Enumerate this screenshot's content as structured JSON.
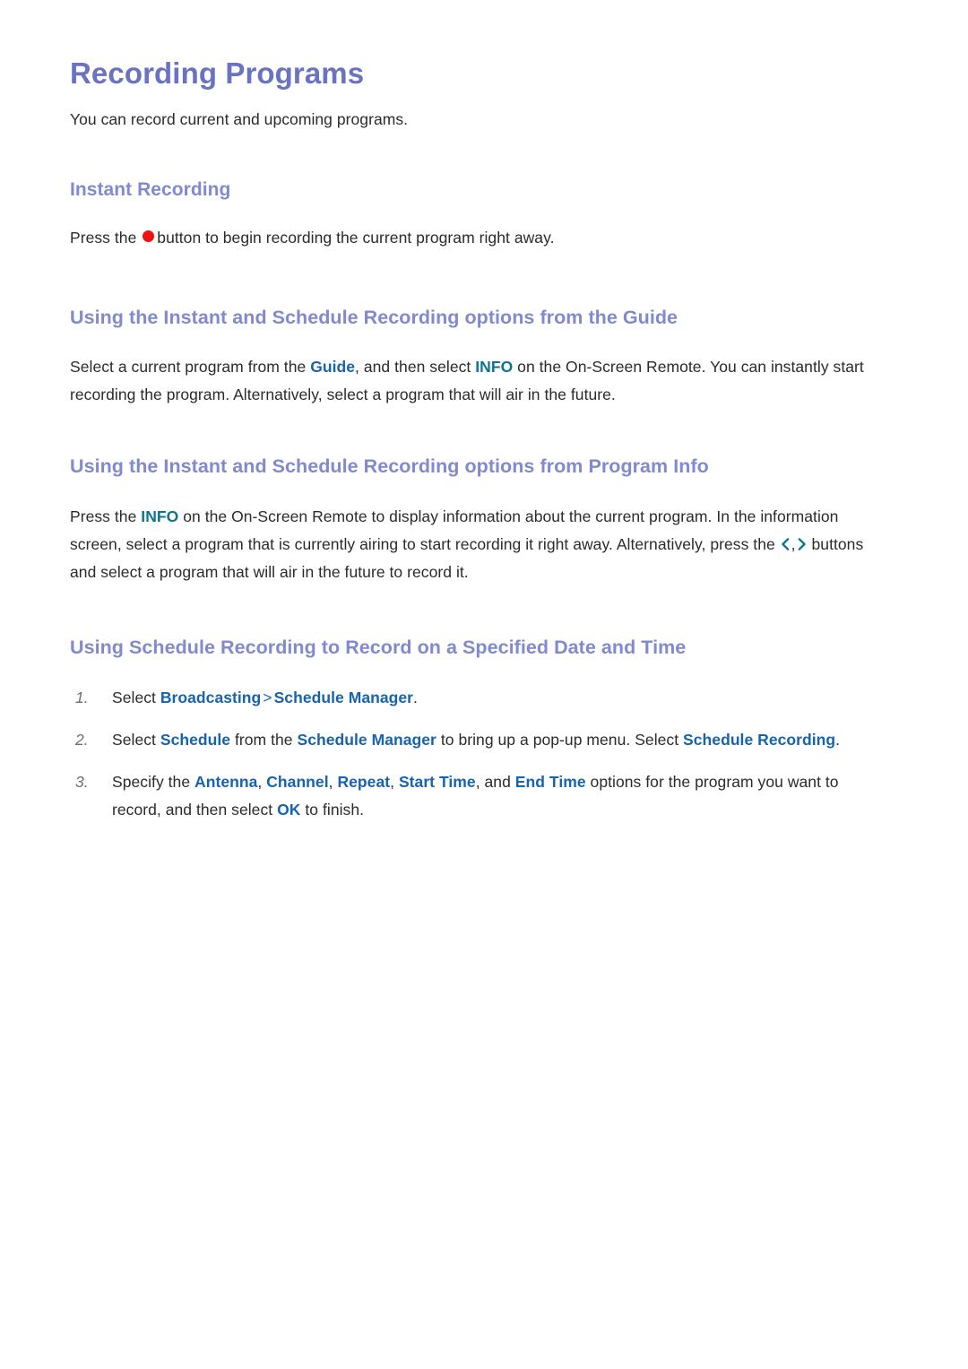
{
  "document": {
    "title": "Recording Programs",
    "intro": "You can record current and upcoming programs."
  },
  "colors": {
    "title": "#6a72c2",
    "heading": "#8189cf",
    "link_blue": "#1763ad",
    "link_teal": "#0d7490",
    "record_red": "#ef1111",
    "body_text": "#2b2b2b",
    "list_number": "#6d6d6d",
    "background": "#ffffff"
  },
  "sections": {
    "instant_recording": {
      "heading": "Instant Recording",
      "text_before_icon": "Press the ",
      "icon": "record-dot-icon",
      "text_after_icon": "button to begin recording the current program right away."
    },
    "guide_options": {
      "heading": "Using the Instant and Schedule Recording options from the Guide",
      "p1a": "Select a current program from the ",
      "token_guide": "Guide",
      "p1b": ", and then select ",
      "token_info": "INFO",
      "p1c": " on the On-Screen Remote. You can instantly start recording the program. Alternatively, select a program that will air in the future."
    },
    "program_info_options": {
      "heading": "Using the Instant and Schedule Recording options from Program Info",
      "p1a": "Press the ",
      "token_info": "INFO",
      "p1b": " on the On-Screen Remote to display information about the current program. In the information screen, select a program that is currently airing to start recording it right away. Alternatively, press the ",
      "icon_left": "chevron-left-icon",
      "comma": ",",
      "icon_right": "chevron-right-icon",
      "p1c": " buttons and select a program that will air in the future to record it."
    },
    "schedule_recording": {
      "heading": "Using Schedule Recording to Record on a Specified Date and Time",
      "steps": [
        {
          "number": "1.",
          "a": "Select ",
          "token1": "Broadcasting",
          "arrow": ">",
          "token2": "Schedule Manager",
          "b": "."
        },
        {
          "number": "2.",
          "a": "Select ",
          "token1": "Schedule",
          "b": " from the ",
          "token2": "Schedule Manager",
          "c": " to bring up a pop-up menu. Select ",
          "token3": "Schedule Recording",
          "d": "."
        },
        {
          "number": "3.",
          "a": "Specify the ",
          "token1": "Antenna",
          "b": ", ",
          "token2": "Channel",
          "c": ", ",
          "token3": "Repeat",
          "d": ", ",
          "token4": "Start Time",
          "e": ", and ",
          "token5": "End Time",
          "f": " options for the program you want to record, and then select ",
          "token6": "OK",
          "g": " to finish."
        }
      ]
    }
  }
}
